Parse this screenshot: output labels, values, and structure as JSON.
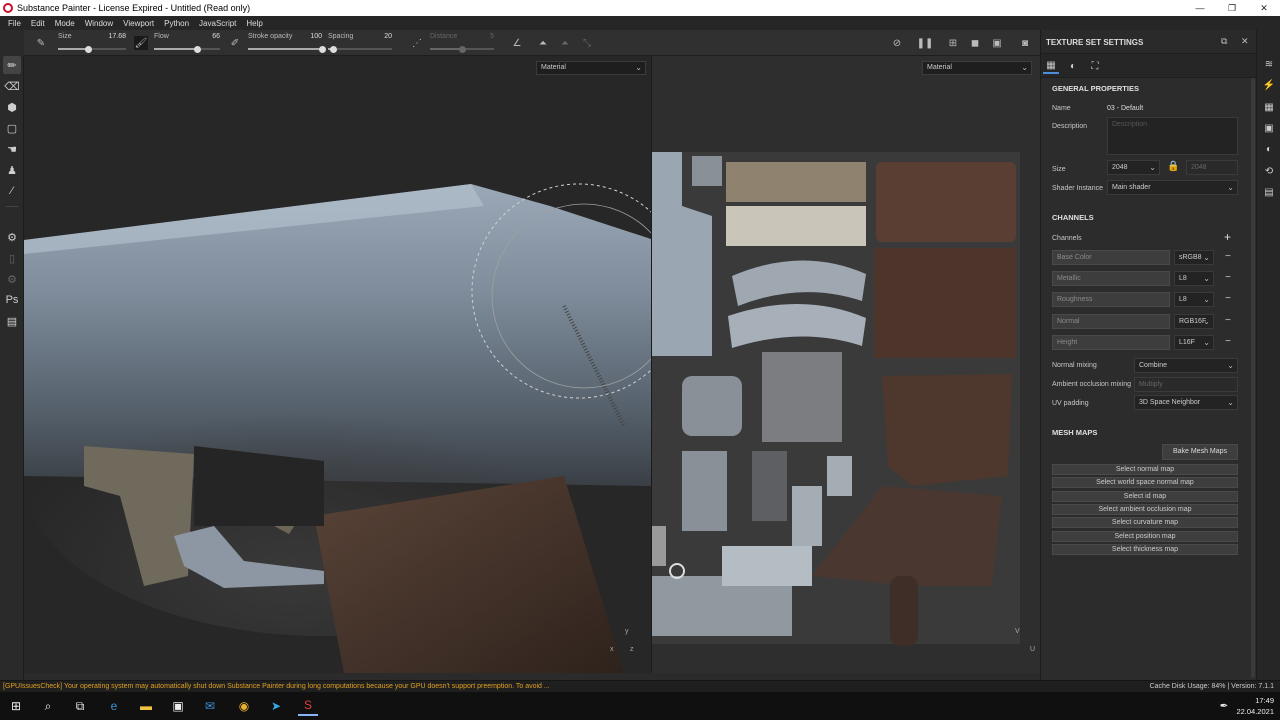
{
  "window": {
    "title": "Substance Painter - License Expired - Untitled (Read only)",
    "minimize": "—",
    "maximize": "❐",
    "close": "✕"
  },
  "menu": [
    "File",
    "Edit",
    "Mode",
    "Window",
    "Viewport",
    "Python",
    "JavaScript",
    "Help"
  ],
  "tool_options": {
    "size_label": "Size",
    "size_value": "17.68",
    "size_fraction": 0.45,
    "flow_label": "Flow",
    "flow_value": "66",
    "flow_fraction": 0.66,
    "stroke_opacity_label": "Stroke opacity",
    "stroke_opacity_value": "100",
    "stroke_opacity_fraction": 1.0,
    "spacing_label": "Spacing",
    "spacing_value": "20",
    "spacing_fraction": 0.08,
    "distance_label": "Distance",
    "distance_value": "5",
    "distance_fraction": 0.5
  },
  "viewports": {
    "left_mode": "Material",
    "right_mode": "Material",
    "axis_3d": {
      "y": "y",
      "x": "x",
      "z": "z"
    },
    "axis_2d": {
      "v": "V",
      "u": "U"
    }
  },
  "panel": {
    "title": "TEXTURE SET SETTINGS",
    "general_title": "GENERAL PROPERTIES",
    "name_label": "Name",
    "name_value": "03 - Default",
    "description_label": "Description",
    "description_placeholder": "Description",
    "size_label": "Size",
    "size_value": "2048",
    "size_linked_value": "2048",
    "shader_label": "Shader Instance",
    "shader_value": "Main shader",
    "channels_title": "CHANNELS",
    "channels_label": "Channels",
    "add": "+",
    "channels": [
      {
        "name": "Base Color",
        "format": "sRGB8"
      },
      {
        "name": "Metallic",
        "format": "L8"
      },
      {
        "name": "Roughness",
        "format": "L8"
      },
      {
        "name": "Normal",
        "format": "RGB16F"
      },
      {
        "name": "Height",
        "format": "L16F"
      }
    ],
    "normal_mixing_label": "Normal mixing",
    "normal_mixing_value": "Combine",
    "ao_mixing_label": "Ambient occlusion mixing",
    "ao_mixing_value": "Multiply",
    "uv_padding_label": "UV padding",
    "uv_padding_value": "3D Space Neighbor",
    "mesh_maps_title": "MESH MAPS",
    "bake_button": "Bake Mesh Maps",
    "mesh_maps": [
      "Select normal map",
      "Select world space normal map",
      "Select id map",
      "Select ambient occlusion map",
      "Select curvature map",
      "Select position map",
      "Select thickness map"
    ]
  },
  "status": {
    "message": "[GPUIssuesCheck] Your operating system may automatically shut down Substance Painter during long computations because your GPU doesn't support preemption. To avoid ...",
    "disk": "Cache Disk Usage:    84%  |  Version: 7.1.1"
  },
  "taskbar": {
    "time": "17:49",
    "date": "22.04.2021"
  }
}
